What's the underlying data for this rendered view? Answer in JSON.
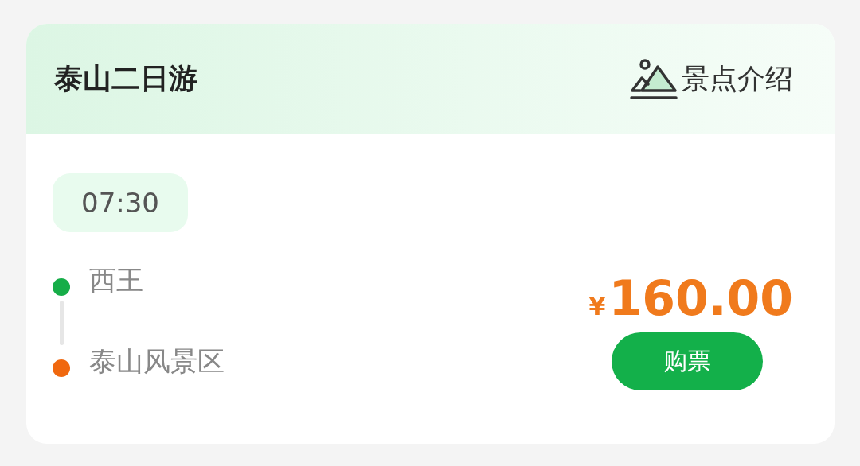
{
  "header": {
    "title": "泰山二日游",
    "link": "景点介绍"
  },
  "departure_time": "07:30",
  "stops": [
    {
      "name": "西王",
      "color": "#16ad48"
    },
    {
      "name": "泰山风景区",
      "color": "#f0680f"
    }
  ],
  "price": {
    "currency": "¥",
    "amount": "160.00"
  },
  "buy_button": "购票"
}
